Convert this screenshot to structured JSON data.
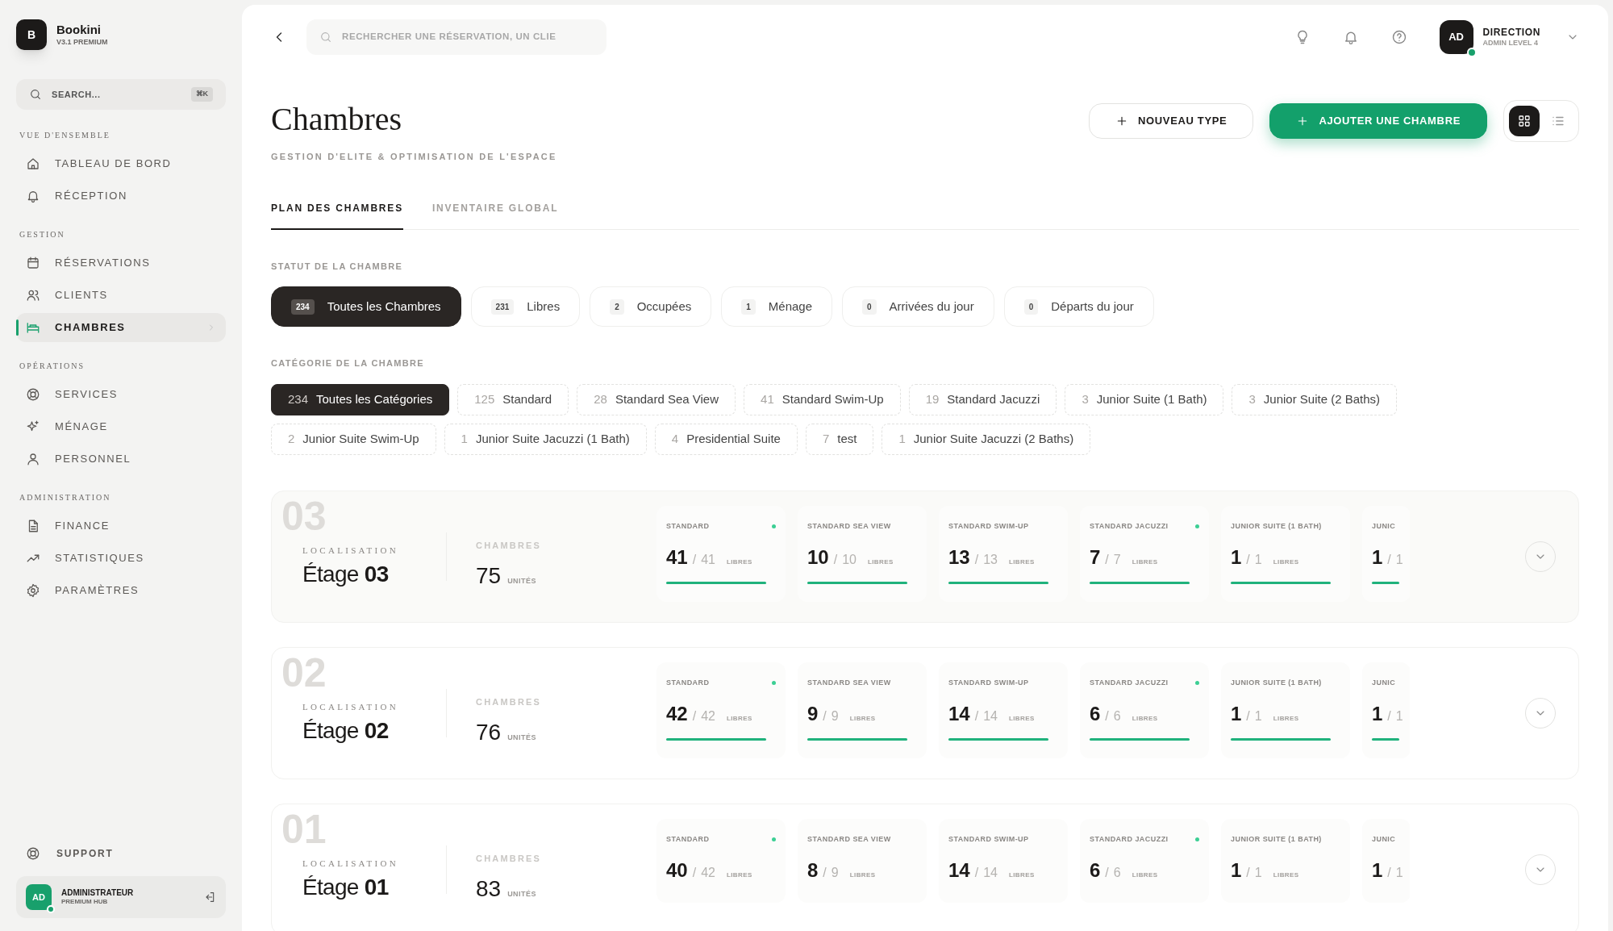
{
  "sidebar": {
    "brand": {
      "logo": "B",
      "name": "Bookini",
      "version": "V3.1 PREMIUM"
    },
    "search": {
      "placeholder": "SEARCH...",
      "shortcut": "⌘K"
    },
    "sections": [
      {
        "title": "VUE D'ENSEMBLE",
        "items": [
          {
            "label": "TABLEAU DE BORD",
            "selected": false
          },
          {
            "label": "RÉCEPTION",
            "selected": false
          }
        ]
      },
      {
        "title": "GESTION",
        "items": [
          {
            "label": "RÉSERVATIONS",
            "selected": false
          },
          {
            "label": "CLIENTS",
            "selected": false
          },
          {
            "label": "CHAMBRES",
            "selected": true
          }
        ]
      },
      {
        "title": "OPÉRATIONS",
        "items": [
          {
            "label": "SERVICES",
            "selected": false
          },
          {
            "label": "MÉNAGE",
            "selected": false
          },
          {
            "label": "PERSONNEL",
            "selected": false
          }
        ]
      },
      {
        "title": "ADMINISTRATION",
        "items": [
          {
            "label": "FINANCE",
            "selected": false
          },
          {
            "label": "STATISTIQUES",
            "selected": false
          },
          {
            "label": "PARAMÈTRES",
            "selected": false
          }
        ]
      }
    ],
    "support": "SUPPORT",
    "user": {
      "initials": "AD",
      "name": "ADMINISTRATEUR",
      "role": "PREMIUM HUB",
      "online": true
    }
  },
  "topbar": {
    "search": {
      "placeholder": "RECHERCHER UNE RÉSERVATION, UN CLIE"
    },
    "user": {
      "initials": "AD",
      "name": "DIRECTION",
      "role": "ADMIN LEVEL 4",
      "online": true
    }
  },
  "header": {
    "title": "Chambres",
    "subtitle": "GESTION D'ELITE & OPTIMISATION DE L'ESPACE",
    "buttons": [
      {
        "label": "NOUVEAU TYPE",
        "kind": "secondary"
      },
      {
        "label": "AJOUTER UNE CHAMBRE",
        "kind": "primary"
      }
    ],
    "view_toggle": [
      {
        "selected": true
      },
      {
        "selected": false
      }
    ]
  },
  "tabs": [
    {
      "label": "PLAN DES CHAMBRES",
      "selected": true
    },
    {
      "label": "INVENTAIRE GLOBAL",
      "selected": false
    }
  ],
  "status_filter": {
    "title": "STATUT DE LA CHAMBRE",
    "chips": [
      {
        "count": "234",
        "label": "Toutes les Chambres",
        "selected": true
      },
      {
        "count": "231",
        "label": "Libres",
        "selected": false
      },
      {
        "count": "2",
        "label": "Occupées",
        "selected": false
      },
      {
        "count": "1",
        "label": "Ménage",
        "selected": false
      },
      {
        "count": "0",
        "label": "Arrivées du jour",
        "selected": false
      },
      {
        "count": "0",
        "label": "Départs du jour",
        "selected": false
      }
    ]
  },
  "category_filter": {
    "title": "CATÉGORIE DE LA CHAMBRE",
    "chips": [
      {
        "count": "234",
        "label": "Toutes les Catégories",
        "selected": true
      },
      {
        "count": "125",
        "label": "Standard",
        "selected": false
      },
      {
        "count": "28",
        "label": "Standard Sea View",
        "selected": false
      },
      {
        "count": "41",
        "label": "Standard Swim-Up",
        "selected": false
      },
      {
        "count": "19",
        "label": "Standard Jacuzzi",
        "selected": false
      },
      {
        "count": "3",
        "label": "Junior Suite (1 Bath)",
        "selected": false
      },
      {
        "count": "3",
        "label": "Junior Suite (2 Baths)",
        "selected": false
      },
      {
        "count": "2",
        "label": "Junior Suite Swim-Up",
        "selected": false
      },
      {
        "count": "1",
        "label": "Junior Suite Jacuzzi (1 Bath)",
        "selected": false
      },
      {
        "count": "4",
        "label": "Presidential Suite",
        "selected": false
      },
      {
        "count": "7",
        "label": "test",
        "selected": false
      },
      {
        "count": "1",
        "label": "Junior Suite Jacuzzi (2 Baths)",
        "selected": false
      }
    ]
  },
  "floors": [
    {
      "badge": "03",
      "location_label": "LOCALISATION",
      "name": "Étage",
      "number": "03",
      "rooms_label": "CHAMBRES",
      "rooms": "75",
      "units_label": "UNITÉS",
      "highlighted": true,
      "categories": [
        {
          "label": "STANDARD",
          "free": "41",
          "separator": "/",
          "total": "41",
          "free_label": "LIBRES",
          "level": 1,
          "dot": true
        },
        {
          "label": "STANDARD SEA VIEW",
          "free": "10",
          "separator": "/",
          "total": "10",
          "free_label": "LIBRES",
          "level": 1,
          "dot": false
        },
        {
          "label": "STANDARD SWIM-UP",
          "free": "13",
          "separator": "/",
          "total": "13",
          "free_label": "LIBRES",
          "level": 1,
          "dot": false
        },
        {
          "label": "STANDARD JACUZZI",
          "free": "7",
          "separator": "/",
          "total": "7",
          "free_label": "LIBRES",
          "level": 1,
          "dot": true
        },
        {
          "label": "JUNIOR SUITE (1 BATH)",
          "free": "1",
          "separator": "/",
          "total": "1",
          "free_label": "LIBRES",
          "level": 1,
          "dot": false
        },
        {
          "label": "JUNIC",
          "free": "1",
          "separator": "/",
          "total": "1",
          "level": 1,
          "dot": false
        }
      ]
    },
    {
      "badge": "02",
      "location_label": "LOCALISATION",
      "name": "Étage",
      "number": "02",
      "rooms_label": "CHAMBRES",
      "rooms": "76",
      "units_label": "UNITÉS",
      "highlighted": false,
      "categories": [
        {
          "label": "STANDARD",
          "free": "42",
          "separator": "/",
          "total": "42",
          "free_label": "LIBRES",
          "level": 1,
          "dot": true
        },
        {
          "label": "STANDARD SEA VIEW",
          "free": "9",
          "separator": "/",
          "total": "9",
          "free_label": "LIBRES",
          "level": 1,
          "dot": false
        },
        {
          "label": "STANDARD SWIM-UP",
          "free": "14",
          "separator": "/",
          "total": "14",
          "free_label": "LIBRES",
          "level": 1,
          "dot": false
        },
        {
          "label": "STANDARD JACUZZI",
          "free": "6",
          "separator": "/",
          "total": "6",
          "free_label": "LIBRES",
          "level": 1,
          "dot": true
        },
        {
          "label": "JUNIOR SUITE (1 BATH)",
          "free": "1",
          "separator": "/",
          "total": "1",
          "free_label": "LIBRES",
          "level": 1,
          "dot": false
        },
        {
          "label": "JUNIC",
          "free": "1",
          "separator": "/",
          "total": "1",
          "level": 1,
          "dot": false
        }
      ]
    },
    {
      "badge": "01",
      "location_label": "LOCALISATION",
      "name": "Étage",
      "number": "01",
      "rooms_label": "CHAMBRES",
      "rooms": "83",
      "units_label": "UNITÉS",
      "highlighted": false,
      "categories": [
        {
          "label": "STANDARD",
          "free": "40",
          "separator": "/",
          "total": "42",
          "free_label": "LIBRES",
          "dot": true
        },
        {
          "label": "STANDARD SEA VIEW",
          "free": "8",
          "separator": "/",
          "total": "9",
          "free_label": "LIBRES",
          "dot": false
        },
        {
          "label": "STANDARD SWIM-UP",
          "free": "14",
          "separator": "/",
          "total": "14",
          "free_label": "LIBRES",
          "dot": false
        },
        {
          "label": "STANDARD JACUZZI",
          "free": "6",
          "separator": "/",
          "total": "6",
          "free_label": "LIBRES",
          "dot": true
        },
        {
          "label": "JUNIOR SUITE (1 BATH)",
          "free": "1",
          "separator": "/",
          "total": "1",
          "free_label": "LIBRES",
          "dot": false
        },
        {
          "label": "JUNIC",
          "free": "1",
          "separator": "/",
          "total": "1",
          "dot": false
        }
      ]
    }
  ]
}
